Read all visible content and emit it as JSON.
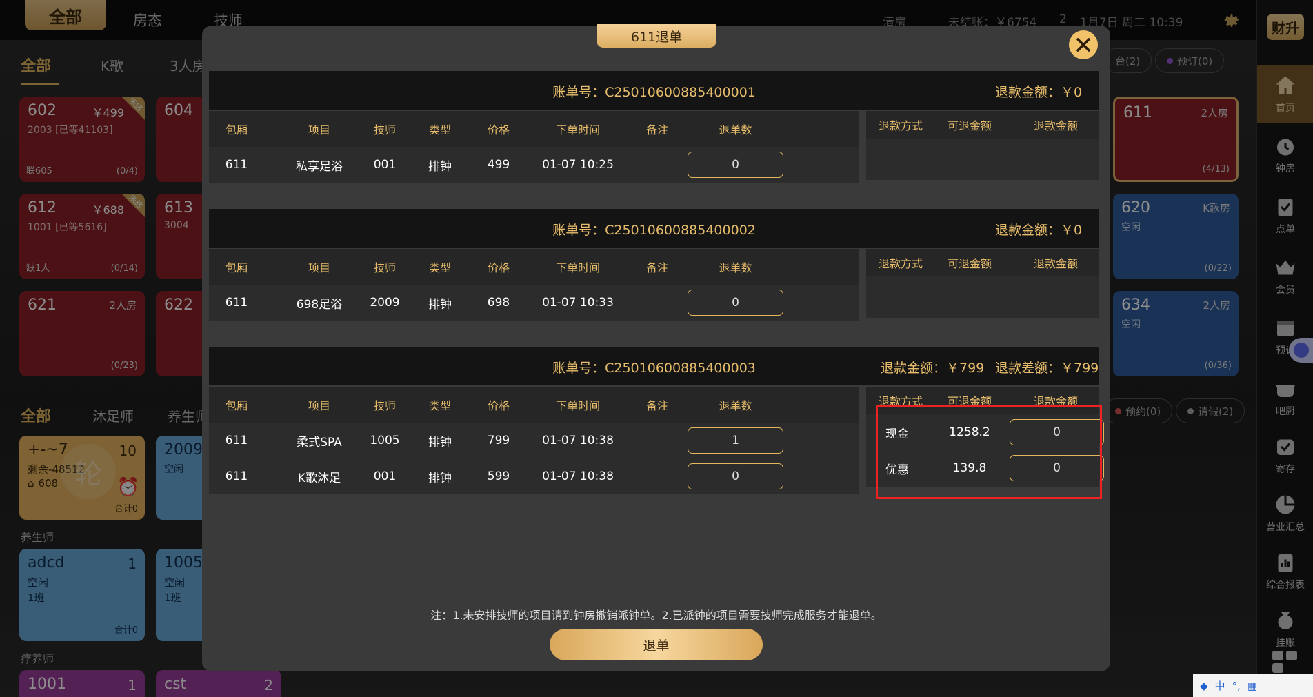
{
  "topbar": {
    "tabs": [
      "全部",
      "房态",
      "技师"
    ],
    "clean": "清房",
    "unpaid": "未结账：￥6754",
    "count": "2",
    "datetime": "1月7日 周二 10:39"
  },
  "room_tabs": [
    "全部",
    "K歌",
    "3人房"
  ],
  "tech_tabs": [
    "全部",
    "沐足师",
    "养生师"
  ],
  "room_cards": [
    {
      "num": "602",
      "price": "￥499",
      "corner": "未结",
      "sub": "2003 [已等41103]",
      "bl": "联605",
      "br": "(0/4)"
    },
    {
      "num": "604"
    },
    {
      "num": "612",
      "price": "￥688",
      "corner": "未结",
      "sub": "1001 [已等5616]",
      "bl": "缺1人",
      "br": "(0/14)"
    },
    {
      "num": "613",
      "sub": "3004"
    },
    {
      "num": "621",
      "rt": "2人房",
      "br": "(0/23)"
    },
    {
      "num": "622"
    }
  ],
  "right_cards": [
    {
      "num": "611",
      "rt": "2人房",
      "br": "(4/13)"
    },
    {
      "num": "620",
      "rt": "K歌房",
      "sub": "空闲",
      "br": "(0/22)"
    },
    {
      "num": "634",
      "rt": "2人房",
      "sub": "空闲",
      "br": "(0/36)"
    }
  ],
  "pills": {
    "a": "台(2)",
    "b": "预订(0)",
    "c": "预约(0)",
    "d": "请假(2)"
  },
  "tech_cards": [
    {
      "num": "+-~7",
      "rt": "10",
      "sub": "剩余-48512",
      "bl": "608",
      "br": "合计0",
      "badge": "轮"
    },
    {
      "num": "2009",
      "sub": "空闲"
    },
    {
      "num": "adcd",
      "rt": "1",
      "sub": "空闲",
      "sub2": "1班",
      "br": "合计0"
    },
    {
      "num": "1005",
      "sub": "空闲",
      "sub2": "1班"
    },
    {
      "num": "1001",
      "rt": "1"
    },
    {
      "num": "cst",
      "rt": "2"
    }
  ],
  "group_labels": [
    "养生师",
    "疗养师"
  ],
  "sidebar": {
    "logo": "财升",
    "items": [
      "首页",
      "钟房",
      "点单",
      "会员",
      "预订",
      "吧厨",
      "寄存",
      "营业汇总",
      "综合报表",
      "挂账"
    ]
  },
  "modal": {
    "title": "611退单",
    "headers": [
      "包厢",
      "项目",
      "技师",
      "类型",
      "价格",
      "下单时间",
      "备注",
      "退单数"
    ],
    "refund_headers": [
      "退款方式",
      "可退金额",
      "退款金额"
    ],
    "bills": [
      {
        "bill_no": "账单号：C25010600885400001",
        "refund_amount": "退款金额：￥0",
        "rows": [
          {
            "room": "611",
            "item": "私享足浴",
            "tech": "001",
            "type": "排钟",
            "price": "499",
            "time": "01-07 10:25",
            "note": "",
            "qty": "0"
          }
        ]
      },
      {
        "bill_no": "账单号：C25010600885400002",
        "refund_amount": "退款金额：￥0",
        "rows": [
          {
            "room": "611",
            "item": "698足浴",
            "tech": "2009",
            "type": "排钟",
            "price": "698",
            "time": "01-07 10:33",
            "note": "",
            "qty": "0"
          }
        ]
      },
      {
        "bill_no": "账单号：C25010600885400003",
        "refund_amount": "退款金额：￥799",
        "refund_diff": "退款差额：￥799",
        "rows": [
          {
            "room": "611",
            "item": "柔式SPA",
            "tech": "1005",
            "type": "排钟",
            "price": "799",
            "time": "01-07 10:38",
            "note": "",
            "qty": "1"
          },
          {
            "room": "611",
            "item": "K歌沐足",
            "tech": "001",
            "type": "排钟",
            "price": "599",
            "time": "01-07 10:38",
            "note": "",
            "qty": "0"
          }
        ],
        "refund_rows": [
          {
            "method": "现金",
            "available": "1258.2",
            "amount": "0"
          },
          {
            "method": "优惠",
            "available": "139.8",
            "amount": "0"
          }
        ]
      }
    ],
    "note": "注：1.未安排技师的项目请到钟房撤销派钟单。2.已派钟的项目需要技师完成服务才能退单。",
    "submit": "退单"
  },
  "ime": {
    "label": "中"
  },
  "colors": {
    "gold": "#e7bd6b",
    "red_card": "#8a2026",
    "blue_card": "#2f5c9d",
    "highlight": "#ee2222"
  }
}
